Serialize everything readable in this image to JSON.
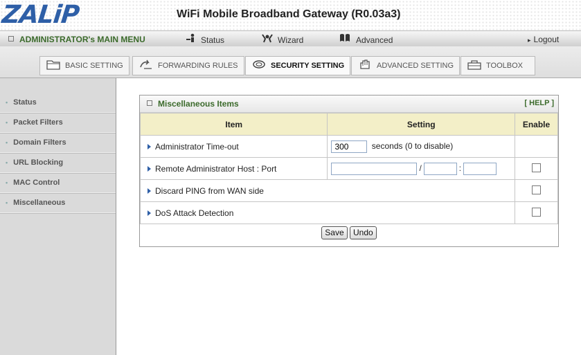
{
  "header": {
    "logo": "ZALiP",
    "title": "WiFi Mobile Broadband Gateway (R0.03a3)"
  },
  "nav": {
    "admin": "ADMINISTRATOR's MAIN MENU",
    "status": "Status",
    "wizard": "Wizard",
    "advanced": "Advanced",
    "logout": "Logout"
  },
  "tabs": [
    {
      "label": "BASIC SETTING"
    },
    {
      "label": "FORWARDING RULES"
    },
    {
      "label": "SECURITY SETTING"
    },
    {
      "label": "ADVANCED SETTING"
    },
    {
      "label": "TOOLBOX"
    }
  ],
  "sidebar": {
    "items": [
      {
        "label": "Status"
      },
      {
        "label": "Packet Filters"
      },
      {
        "label": "Domain Filters"
      },
      {
        "label": "URL Blocking"
      },
      {
        "label": "MAC Control"
      },
      {
        "label": "Miscellaneous"
      }
    ]
  },
  "panel": {
    "title": "Miscellaneous Items",
    "help": "[ HELP ]",
    "columns": {
      "item": "Item",
      "setting": "Setting",
      "enable": "Enable"
    },
    "rows": [
      {
        "item": "Administrator Time-out",
        "value": "300",
        "suffix": "seconds (0 to disable)"
      },
      {
        "item": "Remote Administrator Host : Port",
        "sep1": "/",
        "sep2": ":"
      },
      {
        "item": "Discard PING from WAN side"
      },
      {
        "item": "DoS Attack Detection"
      }
    ],
    "save": "Save",
    "undo": "Undo"
  }
}
